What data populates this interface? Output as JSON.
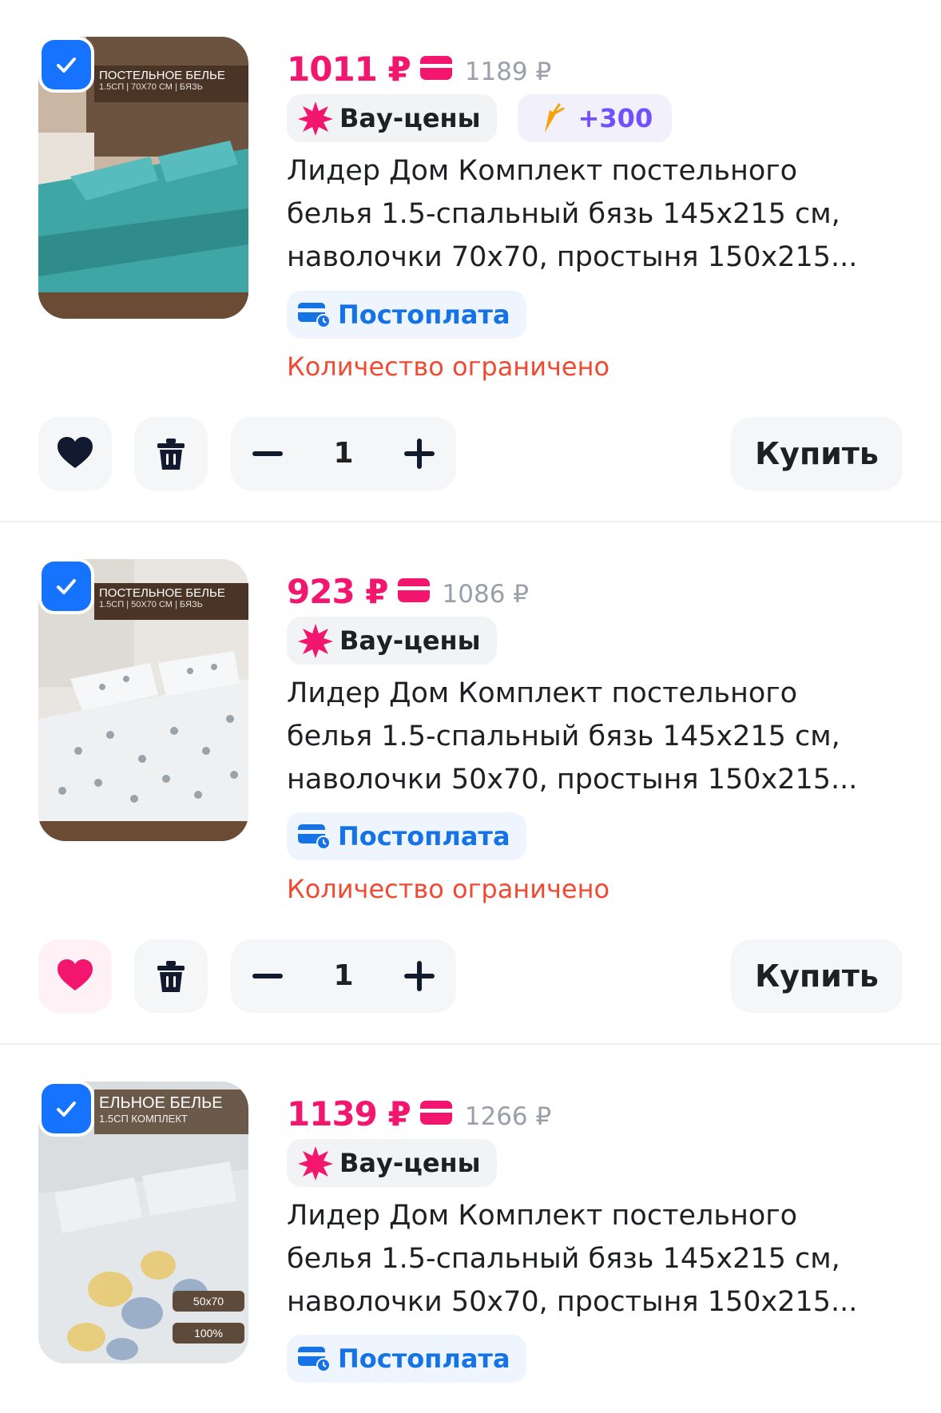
{
  "items": [
    {
      "price": "1011 ₽",
      "old_price": "1189 ₽",
      "badges": {
        "wow": "Вау-цены",
        "bonus": "+300"
      },
      "title_lines": [
        "Лидер Дом Комплект постельного",
        "белья 1.5-спальный бязь 145х215 см,",
        "наволочки 70х70, простыня 150х215..."
      ],
      "postpay": "Постоплата",
      "limited": "Количество ограничено",
      "image": {
        "banner_title": "ПОСТЕЛЬНОЕ БЕЛЬЕ",
        "banner_sub": "1.5СП | 70Х70 СМ | БЯЗЬ",
        "bed_color": "#3ea7a6"
      },
      "favorite": false,
      "quantity": "1",
      "buy_label": "Купить"
    },
    {
      "price": "923 ₽",
      "old_price": "1086 ₽",
      "badges": {
        "wow": "Вау-цены"
      },
      "title_lines": [
        "Лидер Дом Комплект постельного",
        "белья 1.5-спальный бязь 145х215 см,",
        "наволочки 50х70, простыня 150х215..."
      ],
      "postpay": "Постоплата",
      "limited": "Количество ограничено",
      "image": {
        "banner_title": "ПОСТЕЛЬНОЕ БЕЛЬЕ",
        "banner_sub": "1.5СП | 50Х70 СМ | БЯЗЬ",
        "bed_color": "#eef0f1"
      },
      "favorite": true,
      "quantity": "1",
      "buy_label": "Купить"
    },
    {
      "price": "1139 ₽",
      "old_price": "1266 ₽",
      "badges": {
        "wow": "Вау-цены"
      },
      "title_lines": [
        "Лидер Дом Комплект постельного",
        "белья 1.5-спальный бязь 145х215 см,",
        "наволочки 50х70, простыня 150х215..."
      ],
      "postpay": "Постоплата",
      "image": {
        "banner_title": "ЕЛЬНОЕ БЕЛЬЕ",
        "banner_sub": "1.5СП КОМПЛЕКТ",
        "tag_size": "50x70",
        "tag_cotton": "100%",
        "bed_color": "#e3e7ea"
      }
    }
  ],
  "colors": {
    "accent_pink": "#f3166f",
    "checkbox_blue": "#1573ff",
    "postpay_blue": "#1673e6",
    "limited_red": "#f04a33",
    "bonus_purple": "#7150ff"
  },
  "icons": [
    "checkbox-checked-icon",
    "card-icon",
    "wow-burst-icon",
    "carrot-icon",
    "postpay-card-icon",
    "heart-icon",
    "trash-icon",
    "minus-icon",
    "plus-icon"
  ]
}
